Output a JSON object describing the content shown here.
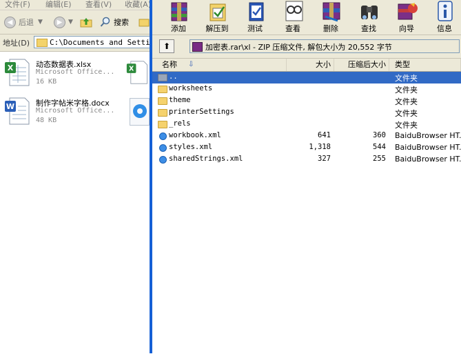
{
  "explorer": {
    "menu": [
      "文件(F)",
      "编辑(E)",
      "查看(V)",
      "收藏(A)"
    ],
    "toolbar": {
      "back_label": "后退",
      "search_label": "搜索"
    },
    "address": {
      "label": "地址(D)",
      "value": "C:\\Documents and Settings"
    },
    "files": [
      {
        "name": "动态数据表.xlsx",
        "type": "Microsoft Office...",
        "size": "16 KB",
        "icon": "excel-file-icon"
      },
      {
        "name": "制作字帖米字格.docx",
        "type": "Microsoft Office...",
        "size": "48 KB",
        "icon": "word-file-icon"
      }
    ]
  },
  "winrar": {
    "toolbar": [
      "添加",
      "解压到",
      "测试",
      "查看",
      "删除",
      "查找",
      "向导",
      "信息"
    ],
    "path": "加密表.rar\\xl - ZIP 压缩文件, 解包大小为 20,552 字节",
    "columns": {
      "name": "名称",
      "size": "大小",
      "packed": "压缩后大小",
      "type": "类型"
    },
    "rows": [
      {
        "name": "..",
        "size": "",
        "packed": "",
        "type": "文件夹",
        "icon": "folder-up-icon",
        "selected": true
      },
      {
        "name": "worksheets",
        "size": "",
        "packed": "",
        "type": "文件夹",
        "icon": "folder-icon",
        "selected": false
      },
      {
        "name": "theme",
        "size": "",
        "packed": "",
        "type": "文件夹",
        "icon": "folder-icon",
        "selected": false
      },
      {
        "name": "printerSettings",
        "size": "",
        "packed": "",
        "type": "文件夹",
        "icon": "folder-icon",
        "selected": false
      },
      {
        "name": "_rels",
        "size": "",
        "packed": "",
        "type": "文件夹",
        "icon": "folder-icon",
        "selected": false
      },
      {
        "name": "workbook.xml",
        "size": "641",
        "packed": "360",
        "type": "BaiduBrowser HT...",
        "icon": "browser-file-icon",
        "selected": false
      },
      {
        "name": "styles.xml",
        "size": "1,318",
        "packed": "544",
        "type": "BaiduBrowser HT...",
        "icon": "browser-file-icon",
        "selected": false
      },
      {
        "name": "sharedStrings.xml",
        "size": "327",
        "packed": "255",
        "type": "BaiduBrowser HT...",
        "icon": "browser-file-icon",
        "selected": false
      }
    ]
  },
  "colors": {
    "selection": "#316ac5",
    "divider": "#1560d6",
    "chrome": "#ece9d8"
  }
}
